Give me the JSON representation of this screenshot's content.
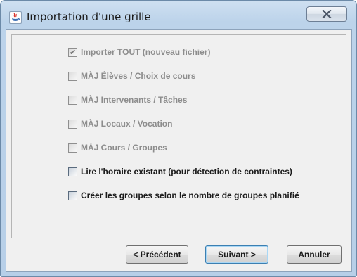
{
  "window": {
    "title": "Importation d'une grille"
  },
  "options": [
    {
      "label": "Importer TOUT (nouveau fichier)",
      "checked": true,
      "enabled": false
    },
    {
      "label": "MÀJ Élèves / Choix de cours",
      "checked": false,
      "enabled": false
    },
    {
      "label": "MÀJ Intervenants / Tâches",
      "checked": false,
      "enabled": false
    },
    {
      "label": "MÀJ Locaux / Vocation",
      "checked": false,
      "enabled": false
    },
    {
      "label": "MÀJ Cours / Groupes",
      "checked": false,
      "enabled": false
    },
    {
      "label": "Lire l'horaire existant (pour détection de contraintes)",
      "checked": false,
      "enabled": true
    },
    {
      "label": "Créer les groupes selon le nombre de groupes planifié",
      "checked": false,
      "enabled": true
    }
  ],
  "buttons": {
    "previous": "< Précédent",
    "next": "Suivant >",
    "cancel": "Annuler"
  },
  "icons": {
    "app": "java-icon",
    "close": "close-icon",
    "check": "check-icon"
  },
  "colors": {
    "titlebar": "#bcd3ea",
    "client_background": "#f0f0f0",
    "disabled_text": "#8d8d8d",
    "enabled_text": "#1b1b1b"
  }
}
